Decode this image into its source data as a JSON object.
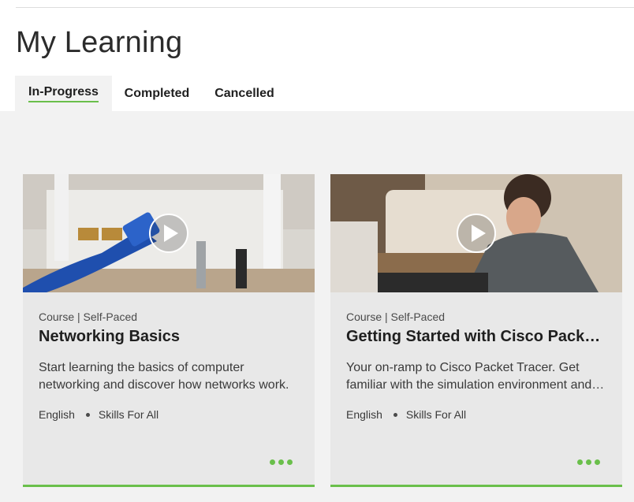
{
  "page": {
    "title": "My Learning"
  },
  "tabs": [
    {
      "label": "In-Progress",
      "active": true
    },
    {
      "label": "Completed",
      "active": false
    },
    {
      "label": "Cancelled",
      "active": false
    }
  ],
  "cards": [
    {
      "meta": "Course | Self-Paced",
      "title": "Networking Basics",
      "description": "Start learning the basics of computer networking and discover how networks work.",
      "language": "English",
      "program": "Skills For All",
      "thumbnail_icon": "play-icon"
    },
    {
      "meta": "Course | Self-Paced",
      "title": "Getting Started with Cisco Packet Tracer",
      "description": "Your on-ramp to Cisco Packet Tracer. Get familiar with the simulation environment and tools.",
      "language": "English",
      "program": "Skills For All",
      "thumbnail_icon": "play-icon"
    }
  ],
  "colors": {
    "accent": "#6abf4b",
    "panel": "#f2f2f2",
    "card": "#e8e8e8"
  }
}
